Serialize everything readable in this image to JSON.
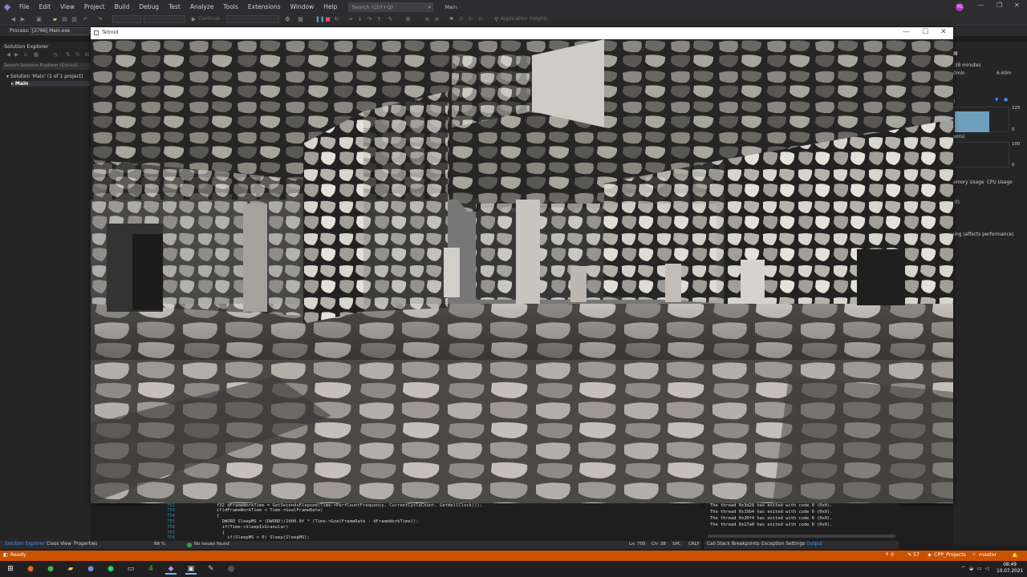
{
  "menubar": {
    "items": [
      "File",
      "Edit",
      "View",
      "Project",
      "Build",
      "Debug",
      "Test",
      "Analyze",
      "Tools",
      "Extensions",
      "Window",
      "Help"
    ],
    "search_placeholder": "Search (Ctrl+Q)",
    "solution_name": "Main",
    "user_initials": "TO"
  },
  "toolbar": {
    "continue_label": "Continue",
    "app_insights_label": "Application Insights"
  },
  "process": {
    "label": "Process:",
    "value": "[2796] Main.exe"
  },
  "solution_explorer": {
    "title": "Solution Explorer",
    "search_placeholder": "Search Solution Explorer (Ctrl+ü)",
    "solution_node": "Solution 'Main' (1 of 1 project)",
    "project_node": "Main"
  },
  "game_window": {
    "title": "Tetroid",
    "controls": [
      "—",
      "☐",
      "✕"
    ]
  },
  "diagnostics": {
    "session_time": ":38 minutes",
    "timeline_start": "0min",
    "timeline_end": "6:40m",
    "section_1": ")",
    "axis_1_max": "225",
    "axis_1_min": "0",
    "section_2": "sors)",
    "axis_2_max": "100",
    "axis_2_min": "0",
    "tab_memory": "emory Usage",
    "tab_cpu": "CPU Usage",
    "count_text": "0)",
    "profiling_text": "ling (affects performance)",
    "memory_bar_level": 0.65
  },
  "code": {
    "lines": [
      {
        "num": "752",
        "text": "f32 dFrameWorkTime = GetSecondsElapsed(Time->PerfCountFrequency, CurrentCycleCount, GetWallClock());"
      },
      {
        "num": "753",
        "text": "if(dFrameWorkTime < Time->GoalFrameRate)"
      },
      {
        "num": "754",
        "text": "{"
      },
      {
        "num": "755",
        "text": "  DWORD SleepMS = (DWORD)(1000.0f * (Time->GoalFrameRate - dFrameWorkTime));"
      },
      {
        "num": "756",
        "text": "  if(Time->SleepIsGranular)"
      },
      {
        "num": "757",
        "text": "  {"
      },
      {
        "num": "758",
        "text": "    if(SleepMS > 0) Sleep(SleepMS);"
      }
    ],
    "zoom": "88 %",
    "issues": "No issues found",
    "position": "Ln: 705",
    "column": "Ch: 38",
    "spacing": "SPC",
    "line_ending": "CRLF"
  },
  "output": {
    "lines": [
      "The thread 0x3d28 has exited with code 0 (0x0).",
      "The thread 0x19b4 has exited with code 0 (0x0).",
      "The thread 0x20f4 has exited with code 0 (0x0).",
      "The thread 0x27a0 has exited with code 0 (0x0)."
    ],
    "tabs": [
      "Call Stack",
      "Breakpoints",
      "Exception Settings",
      "Output"
    ]
  },
  "left_tabs": [
    "Solution Explorer",
    "Class View",
    "Properties"
  ],
  "statusbar": {
    "ready": "Ready",
    "errors": "0",
    "changes": "57",
    "repo": "CPP_Projects",
    "branch": "master"
  },
  "taskbar": {
    "time": "08:49",
    "date": "10.07.2021"
  },
  "colors": {
    "accent_status": "#ca5100",
    "vs_dark": "#2d2d30",
    "editor_bg": "#1e1e1e",
    "panel_bg": "#252526",
    "link_blue": "#3794ff"
  }
}
